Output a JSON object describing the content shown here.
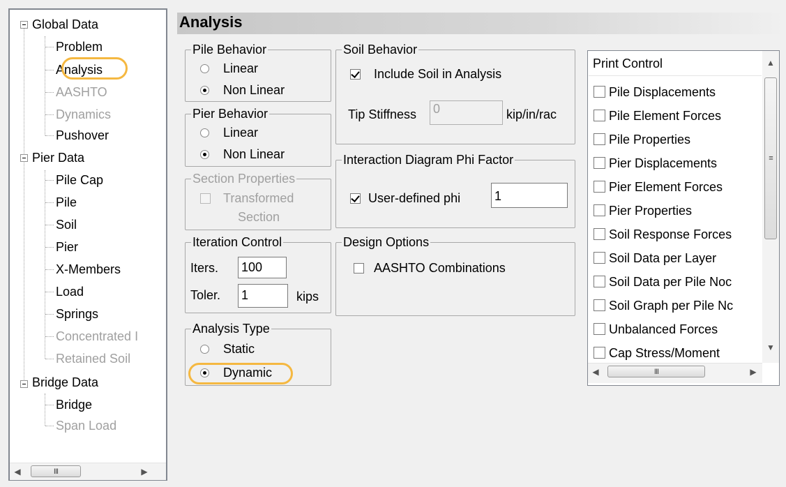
{
  "tree": {
    "nodes": [
      {
        "label": "Global Data",
        "disabled": false
      },
      {
        "label": "Problem",
        "disabled": false
      },
      {
        "label": "Analysis",
        "disabled": false
      },
      {
        "label": "AASHTO",
        "disabled": true
      },
      {
        "label": "Dynamics",
        "disabled": true
      },
      {
        "label": "Pushover",
        "disabled": false
      },
      {
        "label": "Pier Data",
        "disabled": false
      },
      {
        "label": "Pile Cap",
        "disabled": false
      },
      {
        "label": "Pile",
        "disabled": false
      },
      {
        "label": "Soil",
        "disabled": false
      },
      {
        "label": "Pier",
        "disabled": false
      },
      {
        "label": "X-Members",
        "disabled": false
      },
      {
        "label": "Load",
        "disabled": false
      },
      {
        "label": "Springs",
        "disabled": false
      },
      {
        "label": "Concentrated I",
        "disabled": true
      },
      {
        "label": "Retained Soil",
        "disabled": true
      },
      {
        "label": "Bridge Data",
        "disabled": false
      },
      {
        "label": "Bridge",
        "disabled": false
      },
      {
        "label": "Span Load",
        "disabled": true
      }
    ],
    "scroll_thumb_label": "III"
  },
  "header": {
    "title": "Analysis"
  },
  "pile_behavior": {
    "legend": "Pile Behavior",
    "opt1": "Linear",
    "opt2": "Non Linear",
    "selected": "Non Linear"
  },
  "pier_behavior": {
    "legend": "Pier Behavior",
    "opt1": "Linear",
    "opt2": "Non Linear",
    "selected": "Non Linear"
  },
  "section_properties": {
    "legend": "Section Properties",
    "line1": "Transformed",
    "line2": "Section",
    "checked": false
  },
  "iteration": {
    "legend": "Iteration Control",
    "iters_label": "Iters.",
    "iters_value": "100",
    "toler_label": "Toler.",
    "toler_value": "1",
    "toler_unit": "kips"
  },
  "analysis_type": {
    "legend": "Analysis Type",
    "opt1": "Static",
    "opt2": "Dynamic",
    "selected": "Dynamic"
  },
  "soil_behavior": {
    "legend": "Soil Behavior",
    "include_label": "Include Soil in Analysis",
    "include_checked": true,
    "tip_label": "Tip Stiffness",
    "tip_value": "0",
    "tip_unit": "kip/in/rac"
  },
  "interaction": {
    "legend": "Interaction Diagram Phi Factor",
    "user_label": "User-defined phi",
    "user_checked": true,
    "phi_value": "1"
  },
  "design": {
    "legend": "Design Options",
    "aashto_label": "AASHTO Combinations",
    "aashto_checked": false
  },
  "print_control": {
    "header": "Print Control",
    "items": [
      "Pile Displacements",
      "Pile Element Forces",
      "Pile Properties",
      "Pier Displacements",
      "Pier Element Forces",
      "Pier Properties",
      "Soil Response Forces",
      "Soil Data per Layer",
      "Soil Data per Pile Noc",
      "Soil Graph per Pile Nc",
      "Unbalanced Forces",
      "Cap Stress/Moment"
    ],
    "hscroll_thumb_label": "III",
    "vscroll_thumb_label": "≡"
  }
}
